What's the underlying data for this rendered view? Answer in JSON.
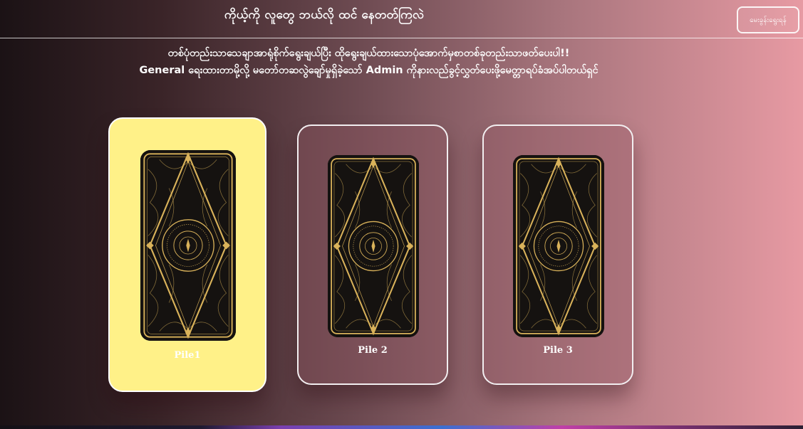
{
  "header": {
    "title": "ကိုယ့်ကို လူတွေ ဘယ်လို ထင် နေတတ်ကြလဲ",
    "ask_button_label": "မေးခွန်းရွေးရန်"
  },
  "instructions": {
    "line1": "တစ်ပုံတည်းသာသေချာအာရုံစိုက်ရွေးချယ်ပြီး ထိုရွေးချယ်ထားသောပုံအောက်မှစာတစ်ခုတည်းသာဖတ်ပေးပါ!!",
    "line2": "General ရေးထားတာမို့လို့ မတော်တဆလွဲချော်မှုရှိခဲ့သော် Admin ကိုနားလည်ခွင့်လွှတ်ပေးဖို့မေတ္တာရပ်ခံအပ်ပါတယ်ရှင်"
  },
  "piles": [
    {
      "label": "Pile1",
      "selected": true
    },
    {
      "label": "Pile 2",
      "selected": false
    },
    {
      "label": "Pile 3",
      "selected": false
    }
  ],
  "colors": {
    "selected_pile_bg": "#fff188",
    "card_gold": "#d9b25a",
    "card_back": "#151210"
  },
  "icons": {
    "card_back": "tarot-card-back-icon"
  }
}
